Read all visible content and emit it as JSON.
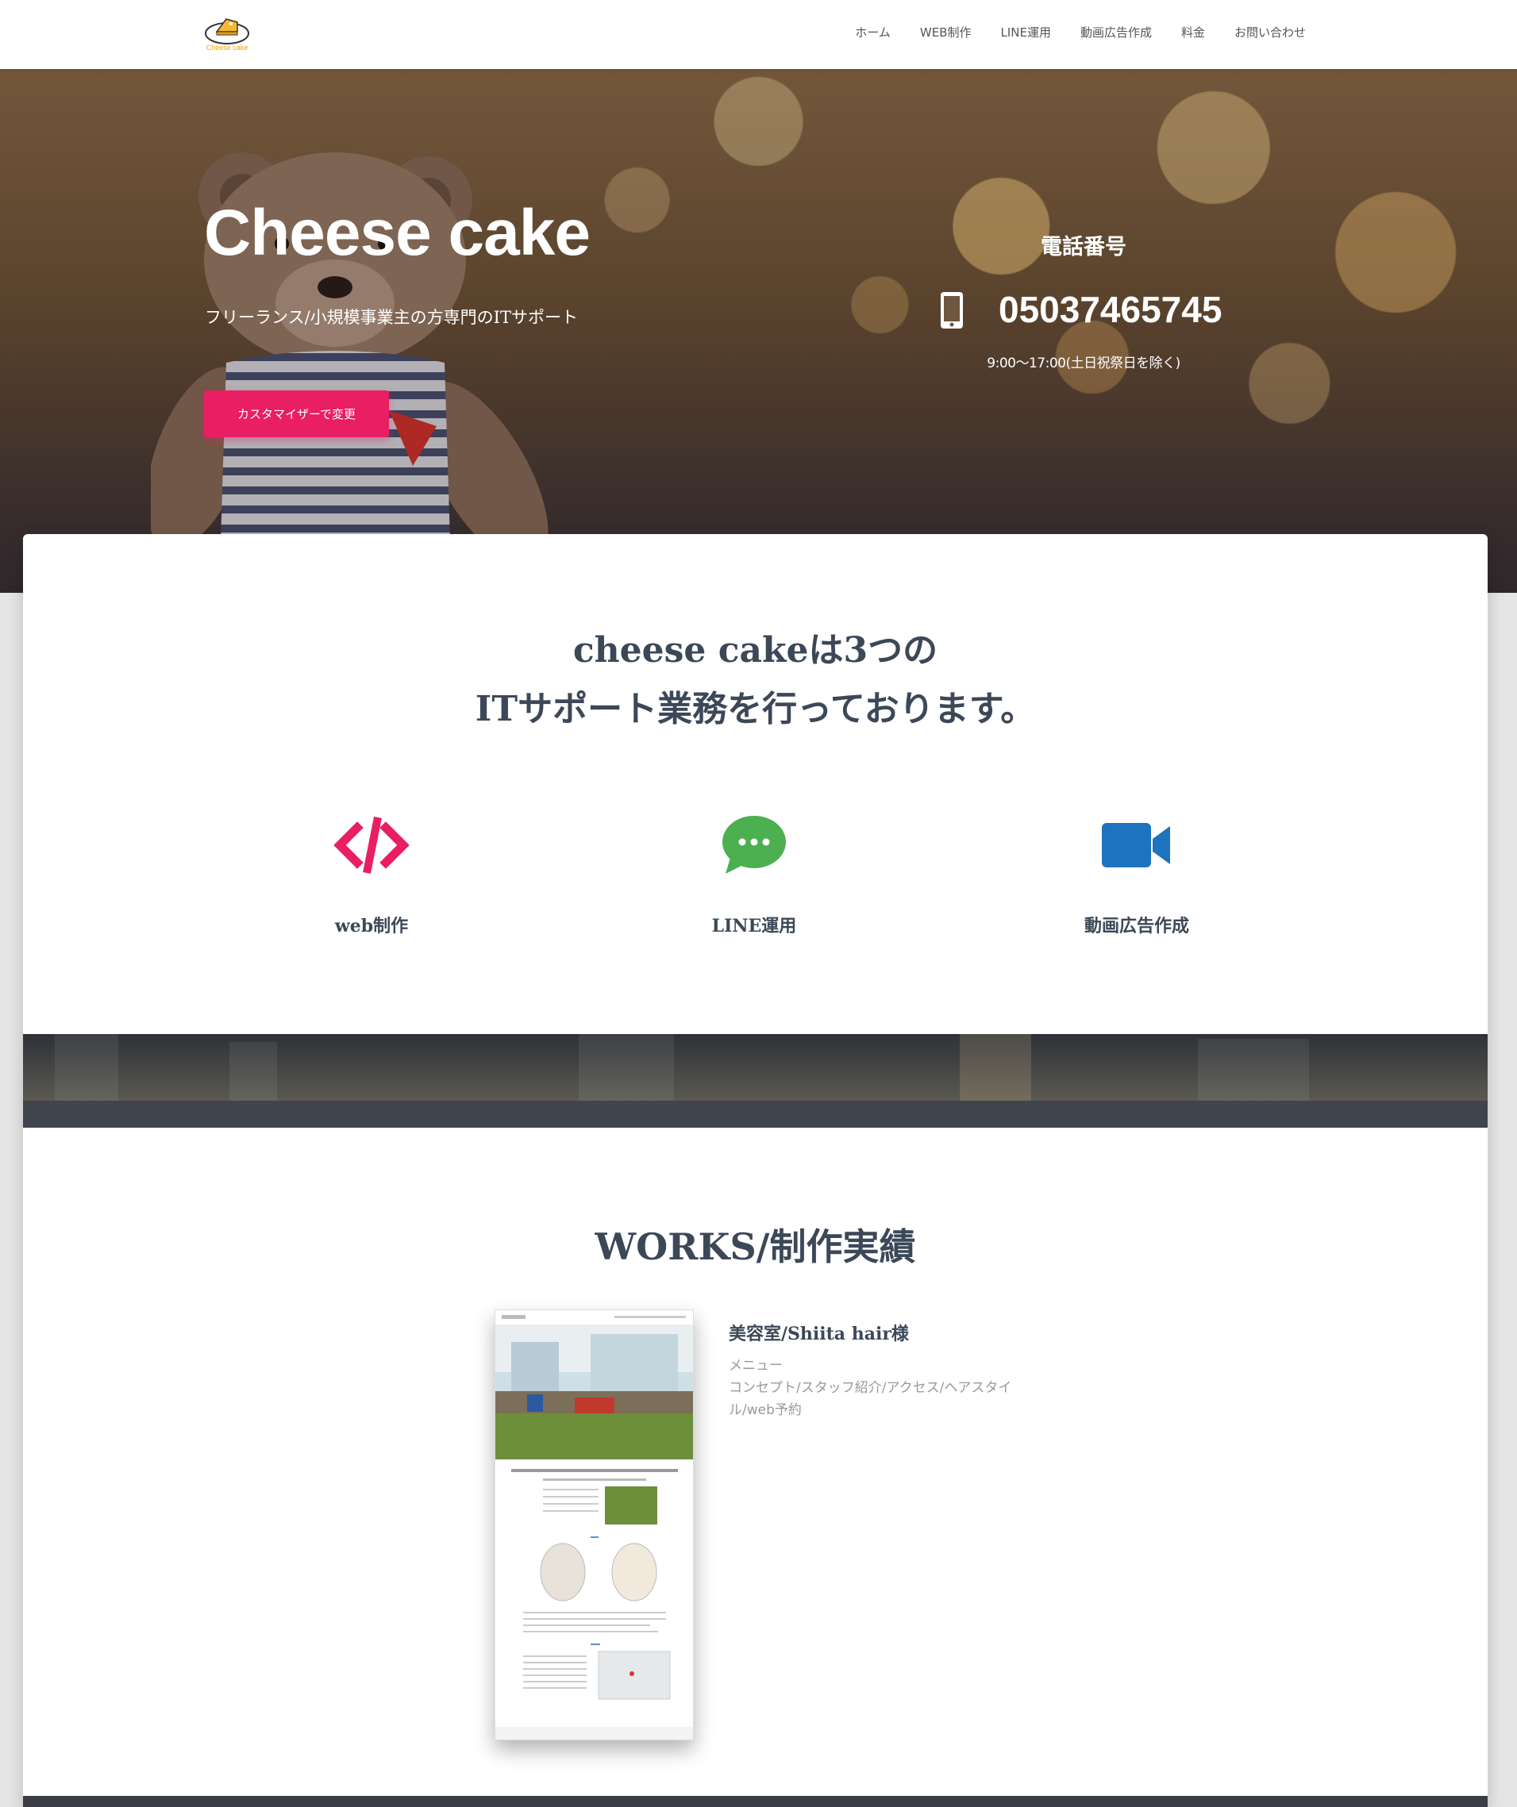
{
  "nav": {
    "logo_text": "Cheese cake",
    "items": [
      "ホーム",
      "WEB制作",
      "LINE運用",
      "動画広告作成",
      "料金",
      "お問い合わせ"
    ]
  },
  "hero": {
    "title": "Cheese cake",
    "subtitle": "フリーランス/小規模事業主の方専門のITサポート",
    "button_label": "カスタマイザーで変更",
    "phone_label": "電話番号",
    "phone_number": "05037465745",
    "phone_hours": "9:00〜17:00(土日祝祭日を除く)"
  },
  "features": {
    "title_line1": "cheese cakeは3つの",
    "title_line2": "ITサポート業務を行っております。",
    "items": [
      {
        "label": "web制作",
        "icon": "code-icon",
        "color": "#e91e63"
      },
      {
        "label": "LINE運用",
        "icon": "chat-bubble-icon",
        "color": "#4caf50"
      },
      {
        "label": "動画広告作成",
        "icon": "video-camera-icon",
        "color": "#1e73be"
      }
    ]
  },
  "works": {
    "title": "WORKS/制作実績",
    "items": [
      {
        "title": "美容室/Shiita hair様",
        "menu_label": "メニュー",
        "description": "コンセプト/スタッフ紹介/アクセス/ヘアスタイル/web予約"
      }
    ]
  },
  "colors": {
    "accent": "#e91e63",
    "text": "#3c4858",
    "muted": "#999999"
  }
}
